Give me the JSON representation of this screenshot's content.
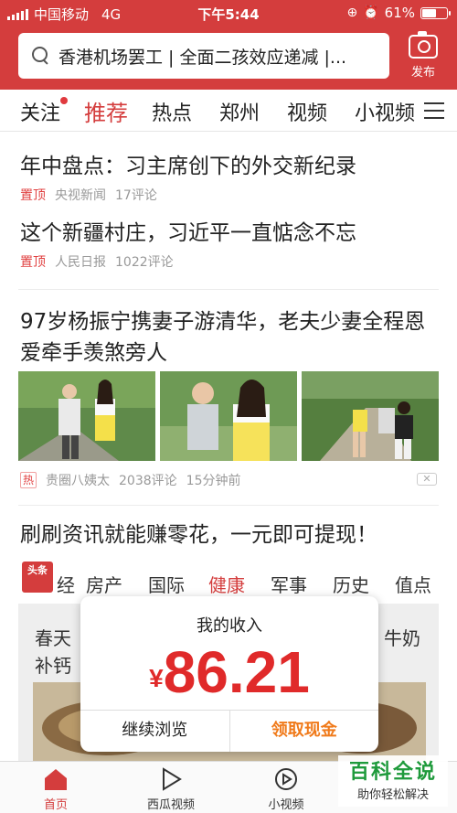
{
  "status_bar": {
    "carrier": "中国移动",
    "network": "4G",
    "time": "下午5:44",
    "battery": "61%",
    "battery_level": 0.61
  },
  "search": {
    "text": "香港机场罢工 | 全面二孩效应递减 |..."
  },
  "publish_label": "发布",
  "tabs": [
    {
      "label": "关注"
    },
    {
      "label": "推荐"
    },
    {
      "label": "热点"
    },
    {
      "label": "郑州"
    },
    {
      "label": "视频"
    },
    {
      "label": "小视频"
    }
  ],
  "feed": [
    {
      "title": "年中盘点：习主席创下的外交新纪录",
      "tag": "置顶",
      "source": "央视新闻",
      "comments": "17评论"
    },
    {
      "title": "这个新疆村庄，习近平一直惦念不忘",
      "tag": "置顶",
      "source": "人民日报",
      "comments": "1022评论"
    },
    {
      "title": "97岁杨振宁携妻子游清华，老夫少妻全程恩爱牵手羡煞旁人",
      "tag": "热",
      "source": "贵圈八姨太",
      "comments": "2038评论",
      "time": "15分钟前"
    },
    {
      "title": "刷刷资讯就能赚零花，一元即可提现！"
    }
  ],
  "ad": {
    "logo": "头条",
    "nav": [
      "经",
      "房产",
      "国际",
      "健康",
      "军事",
      "历史",
      "值点"
    ],
    "line1_left": "春天",
    "line1_right": "牛奶",
    "line2_left": "补钙"
  },
  "popup": {
    "title": "我的收入",
    "currency": "¥",
    "amount": "86.21",
    "continue": "继续浏览",
    "claim": "领取现金"
  },
  "bottom_nav": [
    {
      "label": "首页",
      "icon": "home-icon"
    },
    {
      "label": "西瓜视频",
      "icon": "play-icon"
    },
    {
      "label": "小视频",
      "icon": "small-video-icon"
    }
  ],
  "watermark": {
    "title": "百科全说",
    "subtitle": "助你轻松解决"
  },
  "colors": {
    "brand_red": "#d43d3d",
    "claim_orange": "#f07a1a",
    "amount_red": "#e02a2a"
  }
}
